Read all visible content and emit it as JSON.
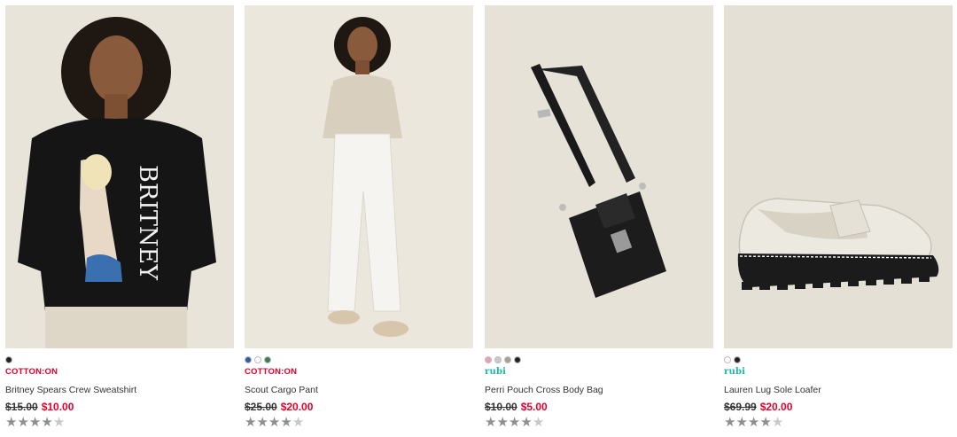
{
  "products": [
    {
      "name": "Britney Spears Crew Sweatshirt",
      "brand": "COTTON:ON",
      "brand_style": "cotton",
      "was_price": "$15.00",
      "now_price": "$10.00",
      "rating": 3.5,
      "swatches": [
        "#222222"
      ],
      "image_text": "BRITNEY",
      "colors": {
        "bg": "#e8e4da"
      }
    },
    {
      "name": "Scout Cargo Pant",
      "brand": "COTTON:ON",
      "brand_style": "cotton",
      "was_price": "$25.00",
      "now_price": "$20.00",
      "rating": 4,
      "swatches": [
        "#2f5e9e",
        "#ffffff",
        "#3b7d4e"
      ],
      "colors": {
        "bg": "#ebe7dd"
      }
    },
    {
      "name": "Perri Pouch Cross Body Bag",
      "brand": "rubi",
      "brand_style": "rubi",
      "was_price": "$10.00",
      "now_price": "$5.00",
      "rating": 3.5,
      "swatches": [
        "#e8a0b8",
        "#c9c9c9",
        "#a8a090",
        "#222222"
      ],
      "colors": {
        "bg": "#e6e2d8"
      }
    },
    {
      "name": "Lauren Lug Sole Loafer",
      "brand": "rubi",
      "brand_style": "rubi",
      "was_price": "$69.99",
      "now_price": "$20.00",
      "rating": 4,
      "swatches": [
        "#ffffff",
        "#222222"
      ],
      "colors": {
        "bg": "#e4e0d5"
      }
    }
  ]
}
